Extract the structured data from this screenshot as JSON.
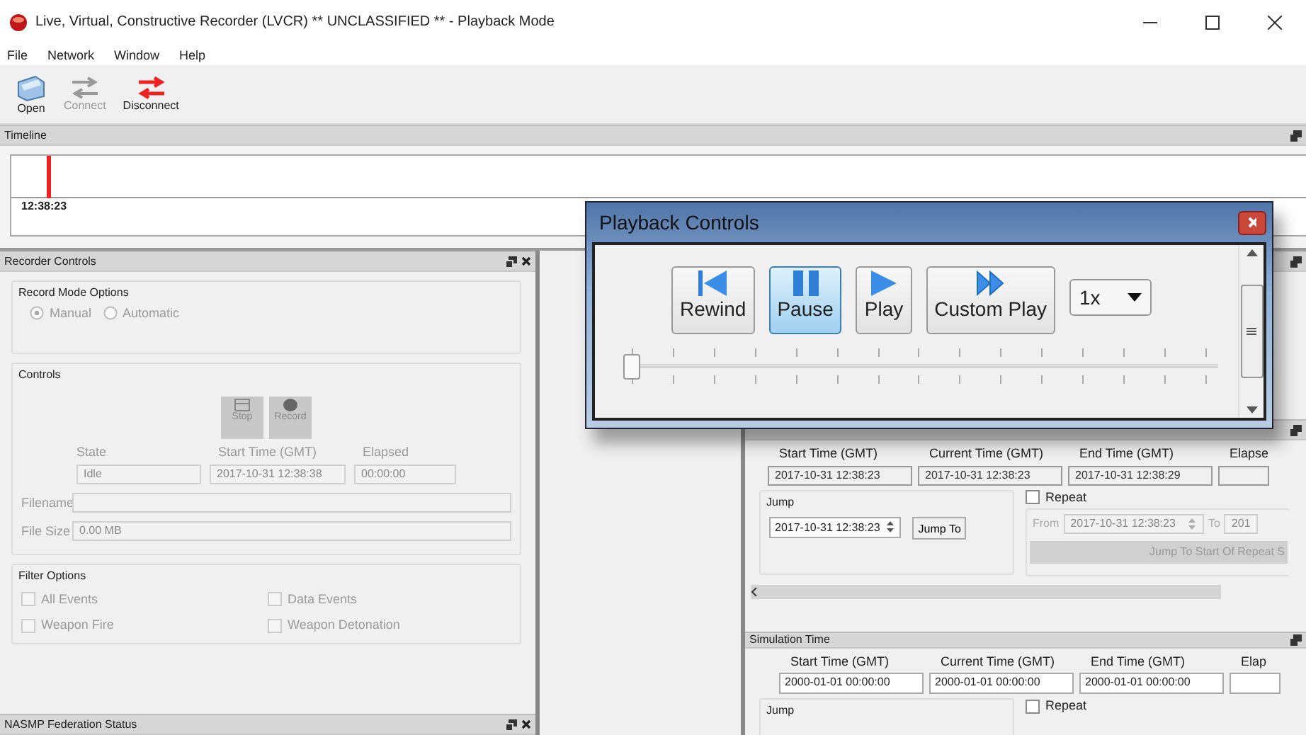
{
  "window": {
    "title": "Live, Virtual, Constructive Recorder (LVCR) ** UNCLASSIFIED ** - Playback Mode"
  },
  "menu": [
    "File",
    "Network",
    "Window",
    "Help"
  ],
  "toolbar": [
    {
      "label": "Open",
      "kind": "open",
      "disabled": false
    },
    {
      "label": "Connect",
      "kind": "connect",
      "disabled": true
    },
    {
      "label": "Disconnect",
      "kind": "disconnect",
      "disabled": false
    }
  ],
  "timeline": {
    "title": "Timeline",
    "marker_time": "12:38:23"
  },
  "recorder_controls": {
    "title": "Recorder Controls",
    "disabled": true,
    "record_mode": {
      "title": "Record Mode Options",
      "options": [
        {
          "label": "Manual",
          "selected": true
        },
        {
          "label": "Automatic",
          "selected": false
        }
      ]
    },
    "controls": {
      "title": "Controls",
      "buttons": [
        {
          "label": "Stop",
          "kind": "stop"
        },
        {
          "label": "Record",
          "kind": "record"
        }
      ],
      "fields": [
        {
          "label": "State",
          "value": "Idle"
        },
        {
          "label": "Start Time (GMT)",
          "value": "2017-10-31 12:38:38"
        },
        {
          "label": "Elapsed",
          "value": "00:00:00"
        }
      ],
      "filename": {
        "label": "Filename"
      },
      "file_size": {
        "label": "File Size",
        "value": "0.00 MB"
      }
    },
    "filter_options": {
      "title": "Filter Options",
      "items": [
        {
          "label": "All Events",
          "checked": false
        },
        {
          "label": "Data Events",
          "checked": false
        },
        {
          "label": "Weapon Fire",
          "checked": false
        },
        {
          "label": "Weapon Detonation",
          "checked": false
        }
      ]
    }
  },
  "federation_status": {
    "title": "NASMP Federation Status"
  },
  "playback_time": {
    "fields": [
      {
        "label": "Start Time (GMT)",
        "value": "2017-10-31 12:38:23"
      },
      {
        "label": "Current Time (GMT)",
        "value": "2017-10-31 12:38:23"
      },
      {
        "label": "End Time (GMT)",
        "value": "2017-10-31 12:38:29"
      },
      {
        "label": "Elapse"
      }
    ],
    "jump": {
      "title": "Jump",
      "value": "2017-10-31 12:38:23",
      "button": "Jump To"
    },
    "repeat": {
      "label": "Repeat",
      "checked": false,
      "from_label": "From",
      "from_value": "2017-10-31 12:38:23",
      "to_label": "To",
      "to_value": "201",
      "button": "Jump To Start Of Repeat S"
    }
  },
  "simulation_time": {
    "title": "Simulation Time",
    "fields": [
      {
        "label": "Start Time (GMT)",
        "value": "2000-01-01 00:00:00"
      },
      {
        "label": "Current Time (GMT)",
        "value": "2000-01-01 00:00:00"
      },
      {
        "label": "End Time (GMT)",
        "value": "2000-01-01 00:00:00"
      },
      {
        "label": "Elap"
      }
    ],
    "jump": {
      "title": "Jump"
    },
    "repeat": {
      "label": "Repeat",
      "checked": false
    }
  },
  "playback_controls": {
    "title": "Playback Controls",
    "buttons": [
      {
        "label": "Rewind",
        "kind": "rewind",
        "selected": false
      },
      {
        "label": "Pause",
        "kind": "pause",
        "selected": true
      },
      {
        "label": "Play",
        "kind": "play",
        "selected": false
      },
      {
        "label": "Custom Play",
        "kind": "custom",
        "selected": false
      }
    ],
    "speed": "1x",
    "position": {
      "level": 0
    }
  }
}
